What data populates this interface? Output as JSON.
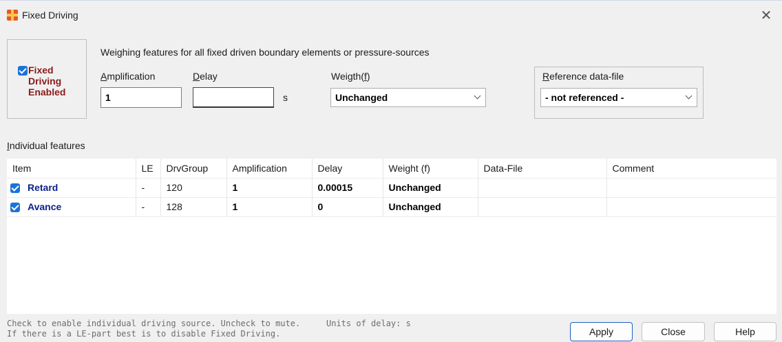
{
  "window": {
    "title": "Fixed Driving",
    "close_glyph": "✕"
  },
  "enable": {
    "label_line1": "Fixed",
    "label_line2": "Driving",
    "label_line3": "Enabled",
    "checked": true
  },
  "weighing": {
    "title": "Weighing features for all fixed driven boundary elements or pressure-sources",
    "amplification_label_pre": "",
    "amplification_label_u": "A",
    "amplification_label_post": "mplification",
    "amplification_value": "1",
    "delay_label_u": "D",
    "delay_label_post": "elay",
    "delay_value": "",
    "delay_unit": "s",
    "weight_label_pre": "Weigth(",
    "weight_label_u": "f",
    "weight_label_post": ")",
    "weight_value": "Unchanged",
    "ref_label_u": "R",
    "ref_label_post": "eference data-file",
    "ref_value": "- not referenced -"
  },
  "individual": {
    "label_u": "I",
    "label_post": "ndividual features",
    "columns": [
      "Item",
      "LE",
      "DrvGroup",
      "Amplification",
      "Delay",
      "Weight (f)",
      "Data-File",
      "Comment"
    ],
    "rows": [
      {
        "item": "Retard",
        "le": "-",
        "group": "120",
        "amp": "1",
        "delay": "0.00015",
        "weight": "Unchanged",
        "file": "",
        "comment": ""
      },
      {
        "item": "Avance",
        "le": "-",
        "group": "128",
        "amp": "1",
        "delay": "0",
        "weight": "Unchanged",
        "file": "",
        "comment": ""
      }
    ]
  },
  "footer": {
    "note_line1": "Check to enable individual driving source. Uncheck to mute.",
    "note_line2": "If there is a LE-part best is to disable Fixed Driving.",
    "units": "Units of delay: s",
    "apply": "Apply",
    "close": "Close",
    "help": "Help"
  }
}
